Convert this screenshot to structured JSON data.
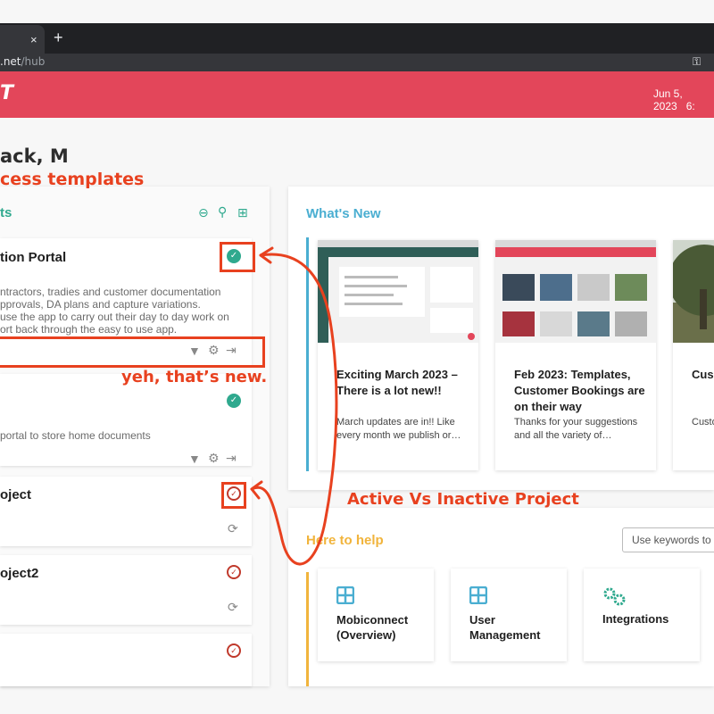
{
  "browser": {
    "tab_close": "×",
    "new_tab": "+",
    "url_main": ".net",
    "url_path": "/hub"
  },
  "header": {
    "logo_text": "T",
    "date": "Jun 5, 2023",
    "time_fragment": "6:"
  },
  "greeting": "ack, M",
  "projects": {
    "title": "ts",
    "cards": [
      {
        "title": "tion Portal",
        "status": "active",
        "desc": [
          "ntractors, tradies and customer documentation",
          "pprovals, DA plans and capture variations.",
          "use the app to carry out their day to day work on",
          "ort back through the easy to use app."
        ]
      },
      {
        "title": "",
        "status": "active",
        "desc": [
          "portal to store home documents"
        ]
      },
      {
        "title": "oject",
        "status": "inactive"
      },
      {
        "title": "oject2",
        "status": "inactive"
      },
      {
        "title": "",
        "status": "inactive"
      }
    ]
  },
  "whats_new": {
    "title": "What's New",
    "items": [
      {
        "title": "Exciting March 2023 – There is a lot new!!",
        "body": "March updates are in!! Like every month we publish or…"
      },
      {
        "title": "Feb 2023: Templates, Customer Bookings are on their way",
        "body": "Thanks for your suggestions and all the variety of…"
      },
      {
        "title": "Cus own",
        "body": "Custo with y"
      }
    ]
  },
  "help": {
    "title": "Here to help",
    "search_placeholder": "Use keywords to",
    "items": [
      {
        "label": "Mobiconnect (Overview)",
        "icon": "grid-icon"
      },
      {
        "label": "User Management",
        "icon": "grid-icon"
      },
      {
        "label": "Integrations",
        "icon": "gears-icon"
      }
    ]
  },
  "annotations": {
    "access": "cess templates",
    "new": "yeh, that’s new.",
    "active": "Active Vs Inactive Project"
  },
  "colors": {
    "brand": "#e3465a",
    "teal": "#2fa98e",
    "blue": "#4aaed1",
    "amber": "#f1b43c",
    "annotation": "#e8411f"
  }
}
